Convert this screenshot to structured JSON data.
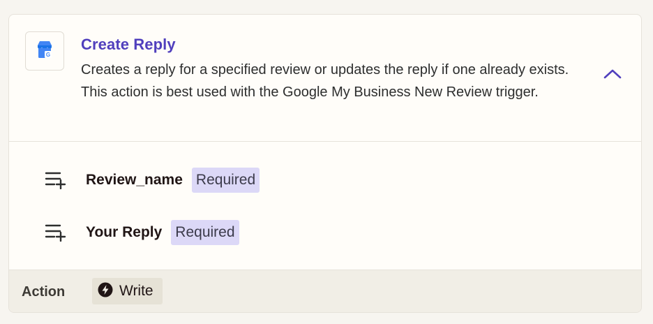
{
  "action": {
    "title": "Create Reply",
    "description": "Creates a reply for a specified review or updates the reply if one already exists. This action is best used with the Google My Business New Review trigger.",
    "app_icon": "google-my-business-icon",
    "collapse_icon": "chevron-up-icon"
  },
  "fields": [
    {
      "name": "Review_name",
      "badge": "Required",
      "icon": "list-add-icon"
    },
    {
      "name": "Your Reply",
      "badge": "Required",
      "icon": "list-add-icon"
    }
  ],
  "footer": {
    "label": "Action",
    "type_label": "Write",
    "type_icon": "lightning-icon"
  },
  "colors": {
    "title": "#503fbd",
    "badge_bg": "#dcd8f7",
    "footer_bg": "#f1eee6",
    "card_bg": "#fffdf9"
  }
}
